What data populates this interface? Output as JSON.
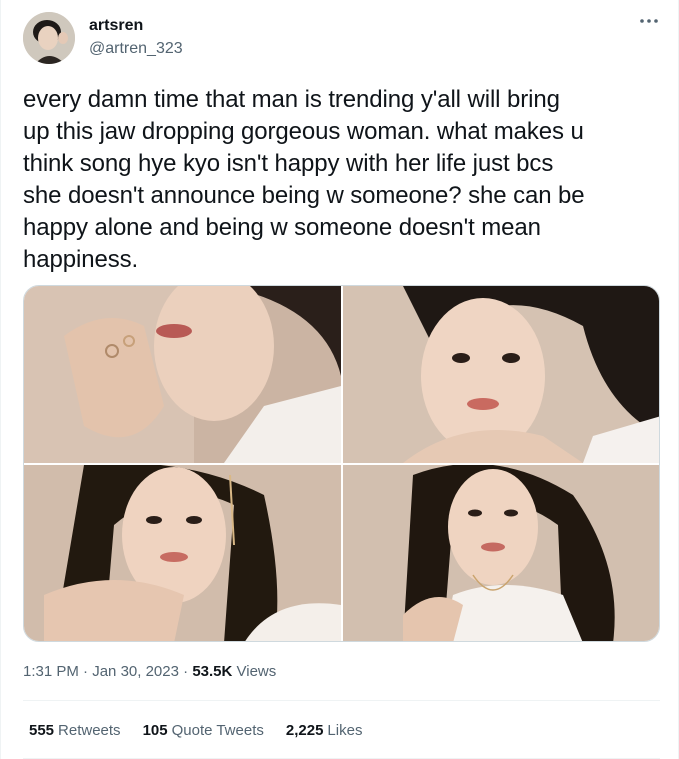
{
  "author": {
    "display_name": "artsren",
    "handle": "@artren_323"
  },
  "more_icon": "more-horizontal-icon",
  "tweet": {
    "text": "every damn time that man is trending y'all will bring\nup this jaw dropping gorgeous woman. what makes u\nthink song hye kyo isn't happy with her life just bcs\nshe doesn't announce being w someone? she can be\nhappy alone and being w someone doesn't mean\nhappiness."
  },
  "meta": {
    "time": "1:31 PM",
    "separator": "·",
    "date": "Jan 30, 2023",
    "views_count": "53.5K",
    "views_label": "Views"
  },
  "stats": {
    "retweets_count": "555",
    "retweets_label": "Retweets",
    "quotes_count": "105",
    "quotes_label": "Quote Tweets",
    "likes_count": "2,225",
    "likes_label": "Likes"
  },
  "colors": {
    "text_primary": "#0f1419",
    "text_secondary": "#536471",
    "border": "#cfd9de"
  }
}
